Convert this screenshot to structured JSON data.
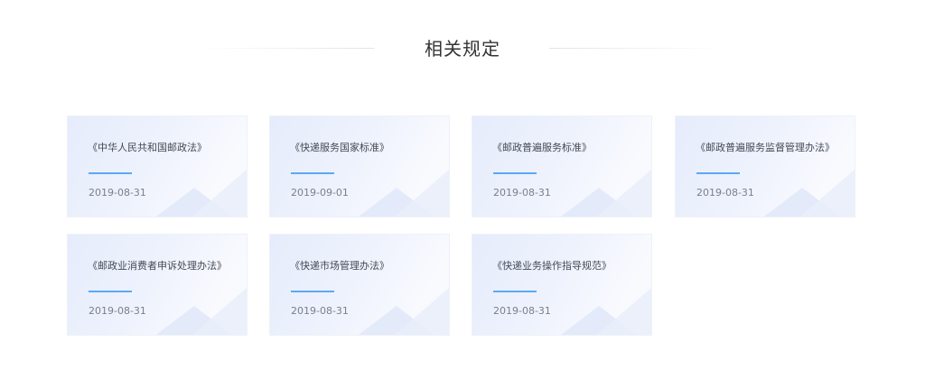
{
  "section": {
    "title": "相关规定"
  },
  "cards": [
    {
      "title": "《中华人民共和国邮政法》",
      "date": "2019-08-31"
    },
    {
      "title": "《快递服务国家标准》",
      "date": "2019-09-01"
    },
    {
      "title": "《邮政普遍服务标准》",
      "date": "2019-08-31"
    },
    {
      "title": "《邮政普遍服务监督管理办法》",
      "date": "2019-08-31"
    },
    {
      "title": "《邮政业消费者申诉处理办法》",
      "date": "2019-08-31"
    },
    {
      "title": "《快递市场管理办法》",
      "date": "2019-08-31"
    },
    {
      "title": "《快递业务操作指导规范》",
      "date": "2019-08-31"
    }
  ],
  "colors": {
    "accent_bar": "#5aa9f7",
    "title_text": "#333333"
  }
}
